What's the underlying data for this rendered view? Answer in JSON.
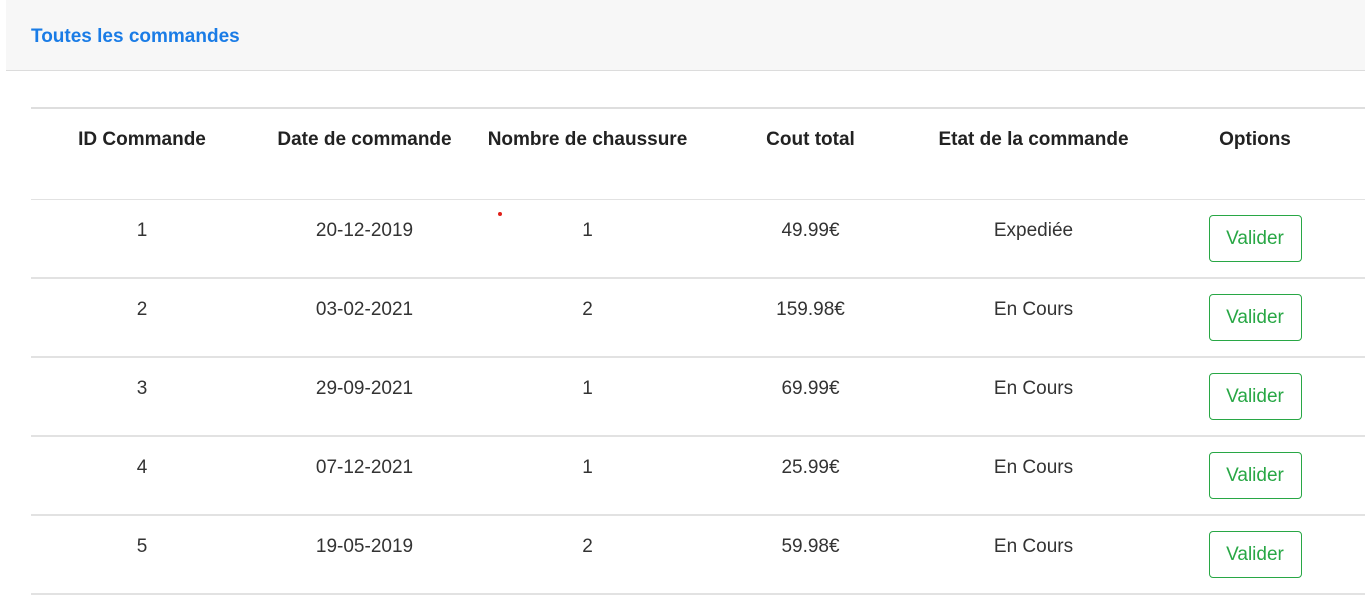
{
  "header": {
    "title": "Toutes les commandes"
  },
  "table": {
    "columns": [
      "ID Commande",
      "Date de commande",
      "Nombre de chaussure",
      "Cout total",
      "Etat de la commande",
      "Options"
    ],
    "rows": [
      {
        "id": "1",
        "date": "20-12-2019",
        "count": "1",
        "total": "49.99€",
        "status": "Expediée",
        "action": "Valider"
      },
      {
        "id": "2",
        "date": "03-02-2021",
        "count": "2",
        "total": "159.98€",
        "status": "En Cours",
        "action": "Valider"
      },
      {
        "id": "3",
        "date": "29-09-2021",
        "count": "1",
        "total": "69.99€",
        "status": "En Cours",
        "action": "Valider"
      },
      {
        "id": "4",
        "date": "07-12-2021",
        "count": "1",
        "total": "25.99€",
        "status": "En Cours",
        "action": "Valider"
      },
      {
        "id": "5",
        "date": "19-05-2019",
        "count": "2",
        "total": "59.98€",
        "status": "En Cours",
        "action": "Valider"
      }
    ]
  },
  "colors": {
    "accent": "#1a7ce6",
    "button": "#28a745",
    "header_bg": "#f7f7f7"
  }
}
